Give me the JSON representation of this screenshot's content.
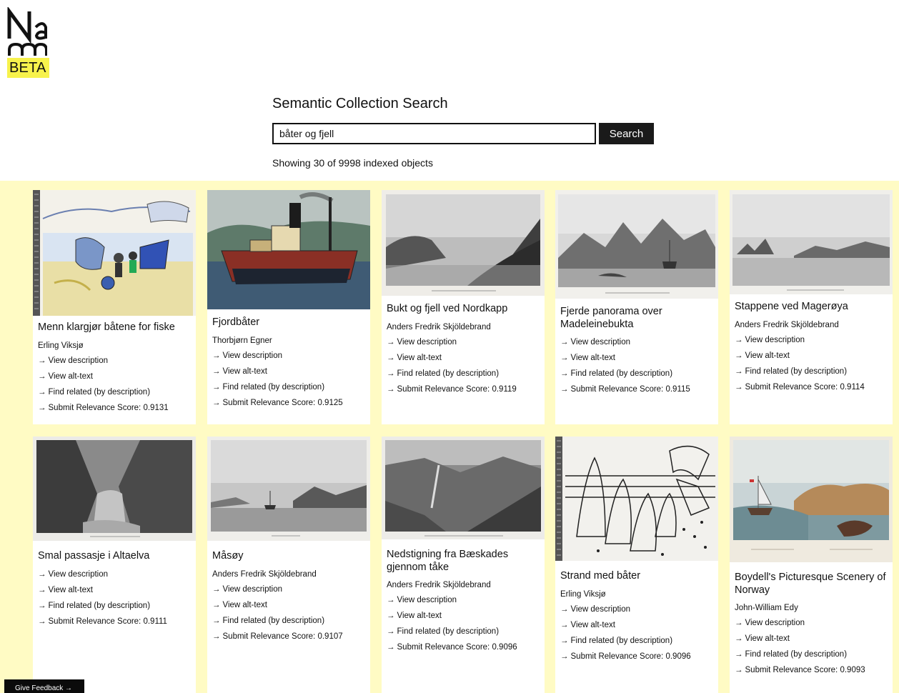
{
  "logo": {
    "badge": "BETA"
  },
  "page": {
    "heading": "Semantic Collection Search"
  },
  "search": {
    "value": "båter og fjell",
    "button_label": "Search"
  },
  "status": "Showing 30 of 9998 indexed objects",
  "link_arrow": "→",
  "labels": {
    "view_description": "View description",
    "view_alt_text": "View alt-text",
    "find_related": "Find related (by description)",
    "score_prefix": "Submit Relevance Score: "
  },
  "results": [
    {
      "title": "Menn klargjør båtene for fiske",
      "artist": "Erling Viksjø",
      "score": "0.9131"
    },
    {
      "title": "Fjordbåter",
      "artist": "Thorbjørn Egner",
      "score": "0.9125"
    },
    {
      "title": "Bukt og fjell ved Nordkapp",
      "artist": "Anders Fredrik Skjöldebrand",
      "score": "0.9119"
    },
    {
      "title": "Fjerde panorama over Madeleinebukta",
      "artist": "",
      "score": "0.9115"
    },
    {
      "title": "Stappene ved Magerøya",
      "artist": "Anders Fredrik Skjöldebrand",
      "score": "0.9114"
    },
    {
      "title": "Smal passasje i Altaelva",
      "artist": "",
      "score": "0.9111"
    },
    {
      "title": "Måsøy",
      "artist": "Anders Fredrik Skjöldebrand",
      "score": "0.9107"
    },
    {
      "title": "Nedstigning fra Bæskades gjennom tåke",
      "artist": "Anders Fredrik Skjöldebrand",
      "score": "0.9096"
    },
    {
      "title": "Strand med båter",
      "artist": "Erling Viksjø",
      "score": "0.9096"
    },
    {
      "title": "Boydell's Picturesque Scenery of Norway",
      "artist": "John-William Edy",
      "score": "0.9093"
    }
  ],
  "feedback": {
    "label": "Give Feedback →"
  }
}
